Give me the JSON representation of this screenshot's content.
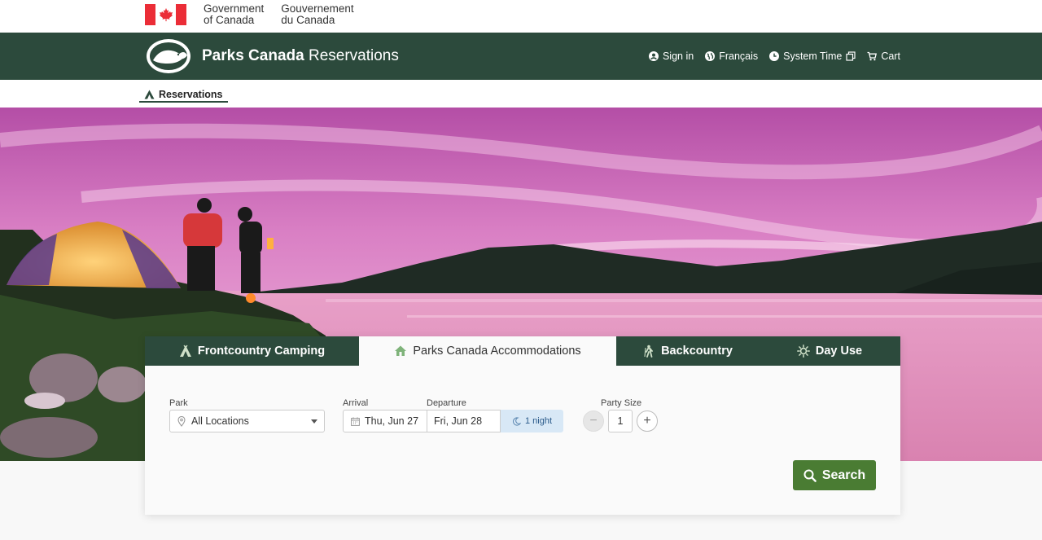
{
  "gov": {
    "en_line1": "Government",
    "en_line2": "of Canada",
    "fr_line1": "Gouvernement",
    "fr_line2": "du Canada"
  },
  "header": {
    "brand_bold": "Parks Canada",
    "brand_light": " Reservations",
    "nav": {
      "sign_in": "Sign in",
      "language": "Français",
      "system_time": "System Time",
      "cart": "Cart"
    }
  },
  "subnav": {
    "reservations": "Reservations"
  },
  "tabs": [
    {
      "label": "Frontcountry Camping",
      "icon": "tent-icon"
    },
    {
      "label": "Parks Canada Accommodations",
      "icon": "house-icon"
    },
    {
      "label": "Backcountry",
      "icon": "hiker-icon"
    },
    {
      "label": "Day Use",
      "icon": "sun-icon"
    }
  ],
  "search": {
    "park_label": "Park",
    "park_value": "All Locations",
    "arrival_label": "Arrival",
    "arrival_value": "Thu, Jun 27",
    "departure_label": "Departure",
    "departure_value": "Fri, Jun 28",
    "nights": "1 night",
    "party_label": "Party Size",
    "party_value": "1",
    "minus": "−",
    "plus": "+",
    "button": "Search"
  },
  "colors": {
    "header_green": "#2c4a3c",
    "search_green": "#4a7c33",
    "flag_red": "#eb2d37"
  }
}
